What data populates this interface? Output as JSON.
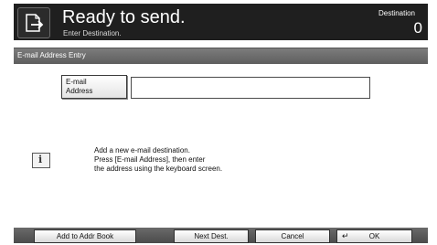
{
  "header": {
    "title": "Ready to send.",
    "subtitle": "Enter Destination.",
    "destination_label": "Destination",
    "destination_count": "0",
    "icon": "send-icon"
  },
  "screen": {
    "title": "E-mail Address Entry"
  },
  "address": {
    "button_label": "E-mail\nAddress",
    "value": ""
  },
  "info": {
    "icon": "info-icon",
    "icon_glyph": "i",
    "lines": [
      "Add a new e-mail destination.",
      "Press [E-mail Address], then enter",
      "the address using the keyboard screen."
    ]
  },
  "bottom": {
    "add_to_addr_book": "Add to Addr Book",
    "next_dest": "Next Dest.",
    "cancel": "Cancel",
    "ok": "OK",
    "ok_icon": "enter-arrow-icon"
  }
}
